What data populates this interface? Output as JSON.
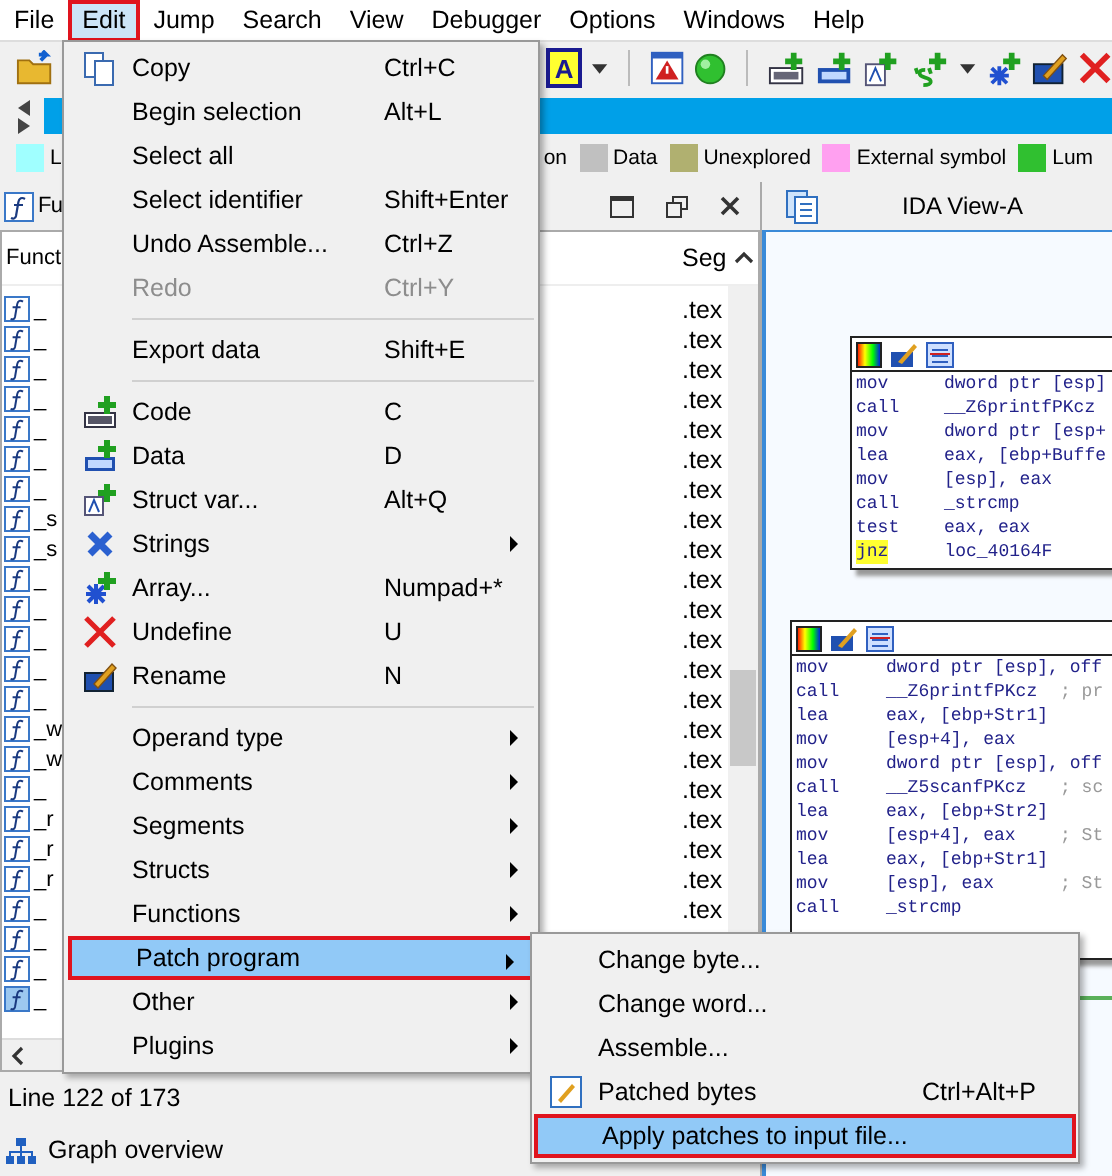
{
  "menu_bar": [
    {
      "label": "File",
      "selected": false,
      "outlined": false
    },
    {
      "label": "Edit",
      "selected": true,
      "outlined": true
    },
    {
      "label": "Jump",
      "selected": false,
      "outlined": false
    },
    {
      "label": "Search",
      "selected": false,
      "outlined": false
    },
    {
      "label": "View",
      "selected": false,
      "outlined": false
    },
    {
      "label": "Debugger",
      "selected": false,
      "outlined": false
    },
    {
      "label": "Options",
      "selected": false,
      "outlined": false
    },
    {
      "label": "Windows",
      "selected": false,
      "outlined": false
    },
    {
      "label": "Help",
      "selected": false,
      "outlined": false
    }
  ],
  "toolbar": {
    "font_button_letter": "A"
  },
  "legend": [
    {
      "label": "L",
      "color": "#a0ffff"
    },
    {
      "label": "on"
    },
    {
      "label": "Data",
      "color": "#c0c0c0"
    },
    {
      "label": "Unexplored",
      "color": "#b0b070"
    },
    {
      "label": "External symbol",
      "color": "#ffa0f0"
    },
    {
      "label": "Lum",
      "color": "#30c030"
    }
  ],
  "functions_panel": {
    "tab_label": "Fu",
    "column_1": "Funct",
    "column_2": "Seg",
    "rows": [
      {
        "name": "_",
        "segment": ".tex",
        "selected": false
      },
      {
        "name": "_",
        "segment": ".tex",
        "selected": false
      },
      {
        "name": "_",
        "segment": ".tex",
        "selected": false
      },
      {
        "name": "_",
        "segment": ".tex",
        "selected": false
      },
      {
        "name": "_",
        "segment": ".tex",
        "selected": false
      },
      {
        "name": "_",
        "segment": ".tex",
        "selected": false
      },
      {
        "name": "_",
        "segment": ".tex",
        "selected": false
      },
      {
        "name": "_s",
        "segment": ".tex",
        "selected": false
      },
      {
        "name": "_s",
        "segment": ".tex",
        "selected": false
      },
      {
        "name": "_",
        "segment": ".tex",
        "selected": false
      },
      {
        "name": "_",
        "segment": ".tex",
        "selected": false
      },
      {
        "name": "_",
        "segment": ".tex",
        "selected": false
      },
      {
        "name": "_",
        "segment": ".tex",
        "selected": false
      },
      {
        "name": "_",
        "segment": ".tex",
        "selected": false
      },
      {
        "name": "_w",
        "segment": ".tex",
        "selected": false
      },
      {
        "name": "_w",
        "segment": ".tex",
        "selected": false
      },
      {
        "name": "_",
        "segment": ".tex",
        "selected": false
      },
      {
        "name": "_r",
        "segment": ".tex",
        "selected": false
      },
      {
        "name": "_r",
        "segment": ".tex",
        "selected": false
      },
      {
        "name": "_r",
        "segment": ".tex",
        "selected": false
      },
      {
        "name": "_",
        "segment": ".tex",
        "selected": false
      },
      {
        "name": "_",
        "selected": false
      },
      {
        "name": "_",
        "selected": false
      },
      {
        "name": "_",
        "selected": true
      }
    ],
    "status": "Line 122 of 173",
    "graph_overview": "Graph overview"
  },
  "ida_view": {
    "tab_label": "IDA View-A",
    "blocks": [
      {
        "lines": [
          {
            "mnemonic": "mov",
            "operand": "dword ptr [esp]",
            "highlighted": false
          },
          {
            "mnemonic": "call",
            "operand": "__Z6printfPKcz",
            "highlighted": false
          },
          {
            "mnemonic": "mov",
            "operand": "dword ptr [esp+",
            "highlighted": false
          },
          {
            "mnemonic": "lea",
            "operand": "eax, [ebp+Buffe",
            "highlighted": false
          },
          {
            "mnemonic": "mov",
            "operand": "[esp], eax",
            "highlighted": false
          },
          {
            "mnemonic": "call",
            "operand": "_strcmp",
            "highlighted": false
          },
          {
            "mnemonic": "test",
            "operand": "eax, eax",
            "highlighted": false
          },
          {
            "mnemonic": "jnz",
            "operand": "loc_40164F",
            "highlighted": true
          }
        ]
      },
      {
        "lines": [
          {
            "mnemonic": "mov",
            "operand": "dword ptr [esp], off",
            "highlighted": false
          },
          {
            "mnemonic": "call",
            "operand": "__Z6printfPKcz",
            "comment": "; pr",
            "highlighted": false
          },
          {
            "mnemonic": "lea",
            "operand": "eax, [ebp+Str1]",
            "highlighted": false
          },
          {
            "mnemonic": "mov",
            "operand": "[esp+4], eax",
            "highlighted": false
          },
          {
            "mnemonic": "mov",
            "operand": "dword ptr [esp], off",
            "highlighted": false
          },
          {
            "mnemonic": "call",
            "operand": "__Z5scanfPKcz",
            "comment": "; sc",
            "highlighted": false
          },
          {
            "mnemonic": "lea",
            "operand": "eax, [ebp+Str2]",
            "highlighted": false
          },
          {
            "mnemonic": "mov",
            "operand": "[esp+4], eax",
            "comment": "; St",
            "highlighted": false
          },
          {
            "mnemonic": "lea",
            "operand": "eax, [ebp+Str1]",
            "highlighted": false
          },
          {
            "mnemonic": "mov",
            "operand": "[esp], eax",
            "comment": "; St",
            "highlighted": false
          },
          {
            "mnemonic": "call",
            "operand": "_strcmp",
            "highlighted": false
          }
        ]
      }
    ]
  },
  "edit_menu": [
    {
      "kind": "item",
      "label": "Copy",
      "shortcut": "Ctrl+C",
      "disabled": false,
      "submenu": false,
      "highlighted": false,
      "outlined": false
    },
    {
      "kind": "item",
      "label": "Begin selection",
      "shortcut": "Alt+L",
      "disabled": false,
      "submenu": false,
      "highlighted": false,
      "outlined": false
    },
    {
      "kind": "item",
      "label": "Select all",
      "disabled": false,
      "submenu": false,
      "highlighted": false,
      "outlined": false
    },
    {
      "kind": "item",
      "label": "Select identifier",
      "shortcut": "Shift+Enter",
      "disabled": false,
      "submenu": false,
      "highlighted": false,
      "outlined": false
    },
    {
      "kind": "item",
      "label": "Undo Assemble...",
      "shortcut": "Ctrl+Z",
      "disabled": false,
      "submenu": false,
      "highlighted": false,
      "outlined": false
    },
    {
      "kind": "item",
      "label": "Redo",
      "shortcut": "Ctrl+Y",
      "disabled": true,
      "submenu": false,
      "highlighted": false,
      "outlined": false
    },
    {
      "kind": "separator"
    },
    {
      "kind": "item",
      "label": "Export data",
      "shortcut": "Shift+E",
      "disabled": false,
      "submenu": false,
      "highlighted": false,
      "outlined": false
    },
    {
      "kind": "separator"
    },
    {
      "kind": "item",
      "label": "Code",
      "shortcut": "C",
      "disabled": false,
      "submenu": false,
      "highlighted": false,
      "outlined": false
    },
    {
      "kind": "item",
      "label": "Data",
      "shortcut": "D",
      "disabled": false,
      "submenu": false,
      "highlighted": false,
      "outlined": false
    },
    {
      "kind": "item",
      "label": "Struct var...",
      "shortcut": "Alt+Q",
      "disabled": false,
      "submenu": false,
      "highlighted": false,
      "outlined": false
    },
    {
      "kind": "item",
      "label": "Strings",
      "disabled": false,
      "submenu": true,
      "highlighted": false,
      "outlined": false
    },
    {
      "kind": "item",
      "label": "Array...",
      "shortcut": "Numpad+*",
      "disabled": false,
      "submenu": false,
      "highlighted": false,
      "outlined": false
    },
    {
      "kind": "item",
      "label": "Undefine",
      "shortcut": "U",
      "disabled": false,
      "submenu": false,
      "highlighted": false,
      "outlined": false
    },
    {
      "kind": "item",
      "label": "Rename",
      "shortcut": "N",
      "disabled": false,
      "submenu": false,
      "highlighted": false,
      "outlined": false
    },
    {
      "kind": "separator"
    },
    {
      "kind": "item",
      "label": "Operand type",
      "disabled": false,
      "submenu": true,
      "highlighted": false,
      "outlined": false
    },
    {
      "kind": "item",
      "label": "Comments",
      "disabled": false,
      "submenu": true,
      "highlighted": false,
      "outlined": false
    },
    {
      "kind": "item",
      "label": "Segments",
      "disabled": false,
      "submenu": true,
      "highlighted": false,
      "outlined": false
    },
    {
      "kind": "item",
      "label": "Structs",
      "disabled": false,
      "submenu": true,
      "highlighted": false,
      "outlined": false
    },
    {
      "kind": "item",
      "label": "Functions",
      "disabled": false,
      "submenu": true,
      "highlighted": false,
      "outlined": false
    },
    {
      "kind": "item",
      "label": "Patch program",
      "disabled": false,
      "submenu": true,
      "highlighted": true,
      "outlined": true
    },
    {
      "kind": "item",
      "label": "Other",
      "disabled": false,
      "submenu": true,
      "highlighted": false,
      "outlined": false
    },
    {
      "kind": "item",
      "label": "Plugins",
      "disabled": false,
      "submenu": true,
      "highlighted": false,
      "outlined": false
    }
  ],
  "patch_submenu": [
    {
      "label": "Change byte...",
      "highlighted": false,
      "outlined": false
    },
    {
      "label": "Change word...",
      "highlighted": false,
      "outlined": false
    },
    {
      "label": "Assemble...",
      "highlighted": false,
      "outlined": false
    },
    {
      "label": "Patched bytes",
      "shortcut": "Ctrl+Alt+P",
      "highlighted": false,
      "outlined": false
    },
    {
      "label": "Apply patches to input file...",
      "highlighted": true,
      "outlined": true
    }
  ]
}
